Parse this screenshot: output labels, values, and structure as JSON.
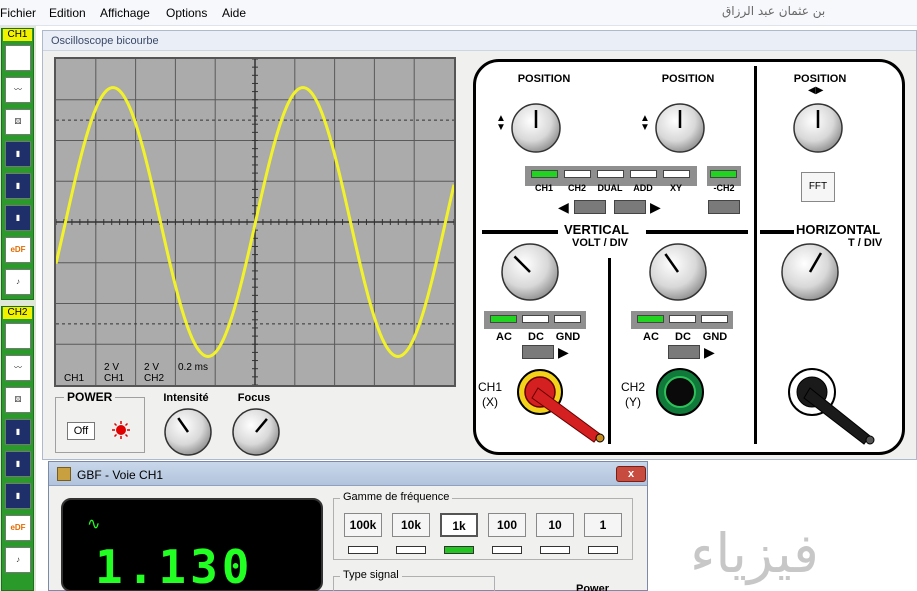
{
  "menu": {
    "items": [
      "Fichier",
      "Edition",
      "Affichage",
      "Options",
      "Aide"
    ],
    "author": "بن عثمان عبد الرزاق"
  },
  "toolbar": {
    "ch1_label": "CH1",
    "ch2_label": "CH2",
    "edf_label": "eDF"
  },
  "oscilloscope": {
    "title": "Oscilloscope bicourbe",
    "screen_labels": {
      "ch1": "CH1",
      "ch1_volt_value": "2 V",
      "ch1_volt_channel": "CH1",
      "ch2_volt_value": "2 V",
      "ch2_volt_channel": "CH2",
      "time_base": "0.2 ms"
    },
    "power": {
      "label": "POWER",
      "off_button": "Off"
    },
    "intensity_label": "Intensité",
    "focus_label": "Focus",
    "trace_color": "#f2f22a",
    "screen_color": "#ababab"
  },
  "panel": {
    "position_label": "POSITION",
    "mode_selector": [
      "CH1",
      "CH2",
      "DUAL",
      "ADD",
      "XY"
    ],
    "mode_selected": "CH1",
    "invert_label": "-CH2",
    "invert_on": true,
    "fft_label": "FFT",
    "vertical_label": "VERTICAL",
    "volt_div_label": "VOLT / DIV",
    "horizontal_label": "HORIZONTAL",
    "time_div_label": "T / DIV",
    "coupling": [
      "AC",
      "DC",
      "GND"
    ],
    "ch1_coupling": "AC",
    "ch2_coupling": "AC",
    "ch1_input": "CH1",
    "ch1_axis": "(X)",
    "ch2_input": "CH2",
    "ch2_axis": "(Y)"
  },
  "gbf": {
    "title": "GBF - Voie CH1",
    "close_label": "x",
    "display_value": "1.130",
    "freq_range_label": "Gamme de fréquence",
    "freq_buttons": [
      "100k",
      "10k",
      "1k",
      "100",
      "10",
      "1"
    ],
    "freq_selected": "1k",
    "signal_type_label": "Type signal",
    "power_label": "Power",
    "display_color": "#22ff22"
  },
  "watermark": "فيزياء"
}
